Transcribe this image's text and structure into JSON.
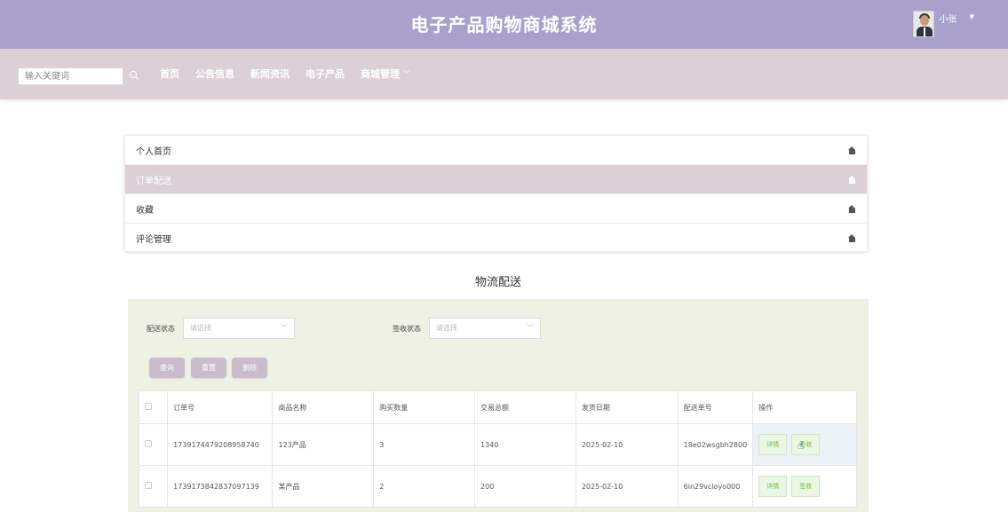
{
  "header": {
    "title": "电子产品购物商城系统",
    "username": "小张"
  },
  "nav": {
    "search_placeholder": "输入关键词",
    "items": [
      {
        "label": "首页"
      },
      {
        "label": "公告信息"
      },
      {
        "label": "新闻资讯"
      },
      {
        "label": "电子产品"
      },
      {
        "label": "商城管理"
      }
    ]
  },
  "menu": {
    "items": [
      {
        "label": "个人首页"
      },
      {
        "label": "订单配送"
      },
      {
        "label": "收藏"
      },
      {
        "label": "评论管理"
      }
    ]
  },
  "section_title": "物流配送",
  "filters": {
    "delivery_label": "配送状态",
    "delivery_placeholder": "请选择",
    "sign_label": "签收状态",
    "sign_placeholder": "请选择"
  },
  "buttons": {
    "query": "查询",
    "reset": "重置",
    "delete": "删除"
  },
  "table": {
    "headers": [
      "订单号",
      "商品名称",
      "购买数量",
      "交易总额",
      "发货日期",
      "配送单号",
      "操作"
    ],
    "rows": [
      {
        "order_no": "1739174479208958740",
        "product": "123产品",
        "qty": "3",
        "total": "1340",
        "date": "2025-02-10",
        "tracking": "18e02wsgbh2800",
        "detail": "详情",
        "sign": "签收"
      },
      {
        "order_no": "1739173842837097139",
        "product": "某产品",
        "qty": "2",
        "total": "200",
        "date": "2025-02-10",
        "tracking": "6in29vcloyo000",
        "detail": "详情",
        "sign": "签收"
      }
    ]
  }
}
